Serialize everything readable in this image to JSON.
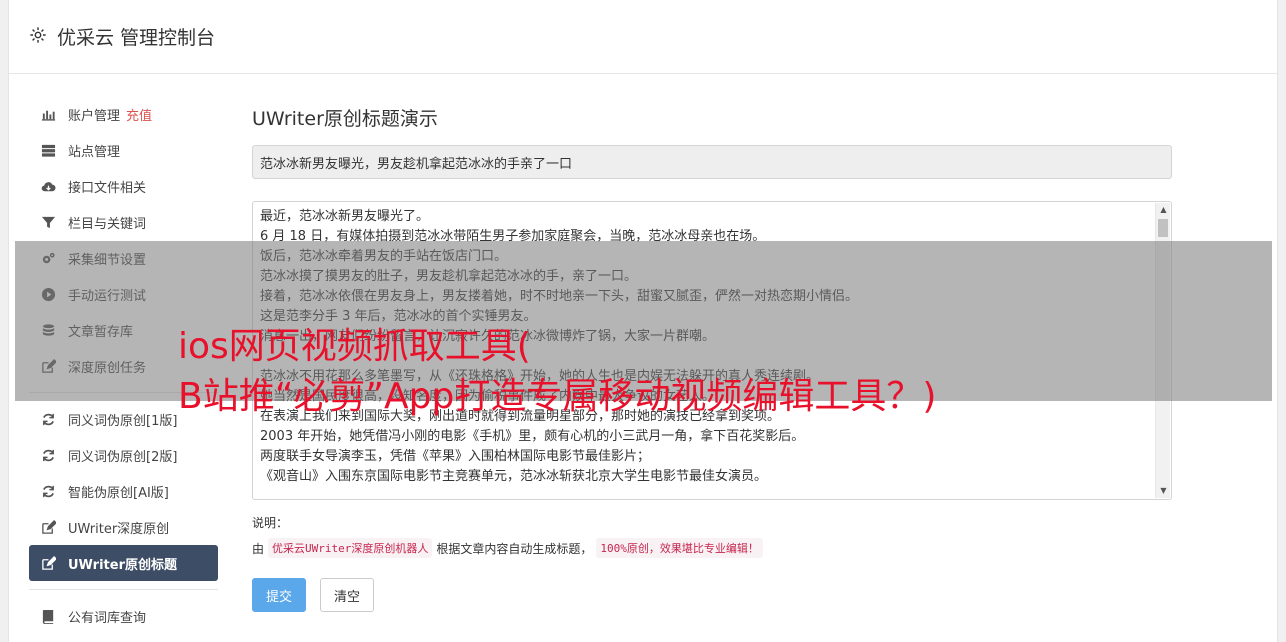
{
  "header": {
    "title": "优采云 管理控制台"
  },
  "sidebar": {
    "group1": [
      {
        "label": "账户管理",
        "badge": "充值",
        "icon": "bar-chart-icon"
      },
      {
        "label": "站点管理",
        "icon": "server-icon"
      },
      {
        "label": "接口文件相关",
        "icon": "cloud-download-icon"
      },
      {
        "label": "栏目与关键词",
        "icon": "filter-icon"
      },
      {
        "label": "采集细节设置",
        "icon": "gears-icon"
      },
      {
        "label": "手动运行测试",
        "icon": "play-icon"
      },
      {
        "label": "文章暂存库",
        "icon": "database-icon"
      },
      {
        "label": "深度原创任务",
        "icon": "edit-icon"
      }
    ],
    "group2": [
      {
        "label": "同义词伪原创[1版]",
        "icon": "refresh-icon"
      },
      {
        "label": "同义词伪原创[2版]",
        "icon": "refresh-icon"
      },
      {
        "label": "智能伪原创[AI版]",
        "icon": "refresh-icon"
      },
      {
        "label": "UWriter深度原创",
        "icon": "edit-icon"
      },
      {
        "label": "UWriter原创标题",
        "icon": "edit-icon",
        "active": true
      }
    ],
    "group3": [
      {
        "label": "公有词库查询",
        "icon": "book-icon"
      }
    ]
  },
  "main": {
    "heading": "UWriter原创标题演示",
    "title_value": "范冰冰新男友曝光，男友趁机拿起范冰冰的手亲了一口",
    "article_lines": [
      "最近，范冰冰新男友曝光了。",
      "6 月 18 日，有媒体拍摄到范冰冰带陌生男子参加家庭聚会，当晚，范冰冰母亲也在场。",
      "饭后，范冰冰牵着男友的手站在饭店门口。",
      "范冰冰摸了摸男友的肚子，男友趁机拿起范冰冰的手，亲了一口。",
      "接着，范冰冰依偎在男友身上，男友搂着她，时不时地亲一下头，甜蜜又腻歪，俨然一对热恋期小情侣。",
      "这是范李分手 3 年后，范冰冰的首个实锤男友。",
      "消息一出，网友们纷纷留言，让沉寂许久的范冰冰微博炸了锅，大家一片群嘲。",
      "",
      "范冰冰不用花那么多笔墨写，从《还珠格格》开始，她的人生也是内娱无法躲开的真人秀连续剧。",
      "她当然是国民度很高，没知名度，因为偷税事件成了内娱中最大争议的女艺人。",
      "在表演上我们来到国际大奖，刚出道时就得到流量明星部分，那时她的演技已经拿到奖项。",
      "2003 年开始，她凭借冯小刚的电影《手机》里，颇有心机的小三武月一角，拿下百花奖影后。",
      "两度联手女导演李玉，凭借《苹果》入围柏林国际电影节最佳影片；",
      "《观音山》入围东京国际电影节主竞赛单元，范冰冰斩获北京大学生电影节最佳女演员。"
    ],
    "note_label": "说明：",
    "note_prefix": "由",
    "note_code1": "优采云UWriter深度原创机器人",
    "note_middle": "根据文章内容自动生成标题，",
    "note_code2": "100%原创，效果堪比专业编辑！",
    "submit_label": "提交",
    "clear_label": "清空"
  },
  "overlay": {
    "line1": "ios网页视频抓取工具(",
    "line2": "B站推“必剪”App打造专属移动视频编辑工具？)"
  },
  "colors": {
    "accent": "#5aa7ea",
    "active_nav": "#3d4d66",
    "badge": "#d9534f",
    "overlay_text": "#e8102a"
  }
}
